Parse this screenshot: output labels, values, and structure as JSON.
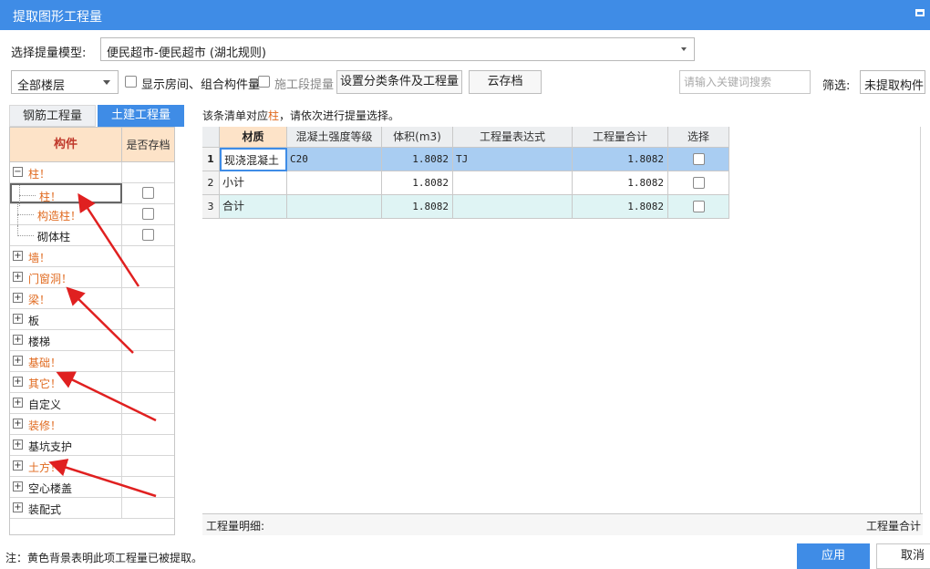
{
  "window": {
    "title": "提取图形工程量"
  },
  "model_select": {
    "label": "选择提量模型:",
    "value": "便民超市-便民超市 (湖北规则)"
  },
  "toolbar": {
    "floor_value": "全部楼层",
    "show_rooms_label": "显示房间、组合构件量",
    "construction_stage_label": "施工段提量",
    "set_classify_button": "设置分类条件及工程量",
    "cloud_save_button": "云存档",
    "search_placeholder": "请输入关键词搜索",
    "filter_label": "筛选:",
    "filter_value": "未提取构件"
  },
  "tabs": [
    {
      "label": "钢筋工程量",
      "active": false
    },
    {
      "label": "土建工程量",
      "active": true
    }
  ],
  "tree": {
    "col_component": "构件",
    "col_saved": "是否存档",
    "rows": [
      {
        "label": "柱！",
        "level": 0,
        "expand": "−",
        "color": "orange"
      },
      {
        "label": "柱！",
        "level": 1,
        "color": "orange",
        "check": true
      },
      {
        "label": "构造柱！",
        "level": 1,
        "color": "orange",
        "check": true
      },
      {
        "label": "砌体柱",
        "level": 1,
        "color": "black",
        "check": true
      },
      {
        "label": "墙！",
        "level": 0,
        "expand": "+",
        "color": "orange"
      },
      {
        "label": "门窗洞！",
        "level": 0,
        "expand": "+",
        "color": "orange"
      },
      {
        "label": "梁！",
        "level": 0,
        "expand": "+",
        "color": "orange"
      },
      {
        "label": "板",
        "level": 0,
        "expand": "+",
        "color": "black"
      },
      {
        "label": "楼梯",
        "level": 0,
        "expand": "+",
        "color": "black"
      },
      {
        "label": "基础！",
        "level": 0,
        "expand": "+",
        "color": "orange"
      },
      {
        "label": "其它！",
        "level": 0,
        "expand": "+",
        "color": "orange"
      },
      {
        "label": "自定义",
        "level": 0,
        "expand": "+",
        "color": "black"
      },
      {
        "label": "装修！",
        "level": 0,
        "expand": "+",
        "color": "orange"
      },
      {
        "label": "基坑支护",
        "level": 0,
        "expand": "+",
        "color": "black"
      },
      {
        "label": "土方！",
        "level": 0,
        "expand": "+",
        "color": "orange"
      },
      {
        "label": "空心楼盖",
        "level": 0,
        "expand": "+",
        "color": "black"
      },
      {
        "label": "装配式",
        "level": 0,
        "expand": "+",
        "color": "black"
      }
    ]
  },
  "notice": {
    "prefix": "该条清单对应",
    "highlight": "柱",
    "suffix": "，请依次进行提量选择。"
  },
  "grid": {
    "headers": [
      "材质",
      "混凝土强度等级",
      "体积(m3)",
      "工程量表达式",
      "工程量合计",
      "选择"
    ],
    "rows": [
      {
        "num": "1",
        "material": "现浇混凝土",
        "grade": "C20",
        "volume": "1.8082",
        "expr": "TJ",
        "total": "1.8082"
      },
      {
        "num": "2",
        "material": "小计",
        "grade": "",
        "volume": "1.8082",
        "expr": "",
        "total": "1.8082"
      },
      {
        "num": "3",
        "material": "合计",
        "grade": "",
        "volume": "1.8082",
        "expr": "",
        "total": "1.8082"
      }
    ]
  },
  "bottom": {
    "detail_label": "工程量明细:",
    "total_label": "工程量合计"
  },
  "footer": {
    "note": "注：黄色背景表明此项工程量已被提取。",
    "apply_button": "应用",
    "cancel_button": "取消"
  },
  "colors": {
    "accent": "#3f8ce6",
    "highlight_text": "#e06a1f",
    "selected_row": "#a9cdf2",
    "total_row": "#dff4f4",
    "arrow": "#e02020"
  }
}
